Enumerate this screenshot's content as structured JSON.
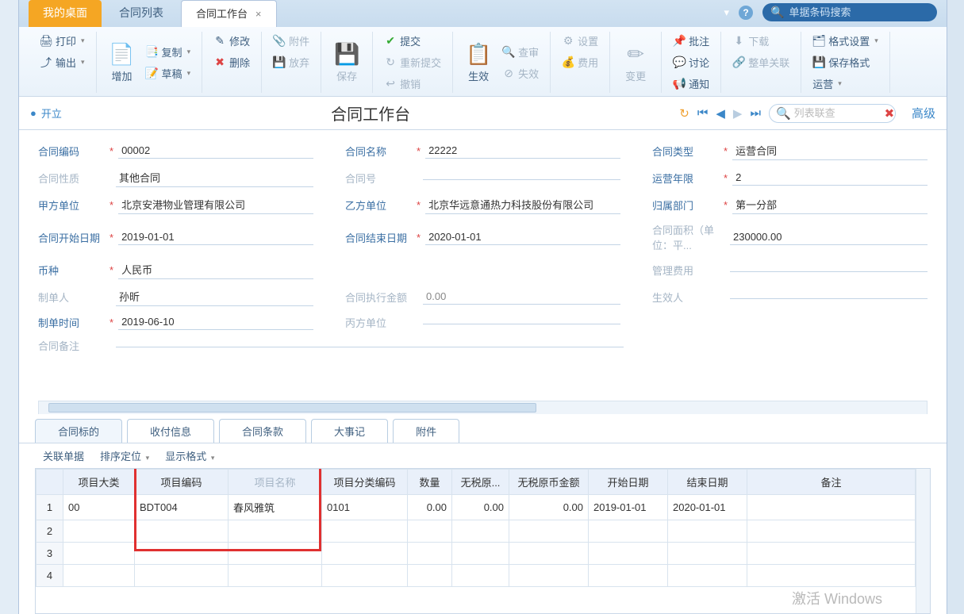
{
  "tabs": {
    "desktop": "我的桌面",
    "list": "合同列表",
    "workbench": "合同工作台",
    "close_x": "×"
  },
  "topsearch": {
    "placeholder": "单据条码搜索"
  },
  "ribbon": {
    "print": "打印",
    "export": "输出",
    "add": "增加",
    "copy": "复制",
    "draft": "草稿",
    "edit": "修改",
    "delete": "删除",
    "attach": "附件",
    "discard": "放弃",
    "save": "保存",
    "submit": "提交",
    "resubmit": "重新提交",
    "revoke": "撤销",
    "effect": "生效",
    "review": "查审",
    "invalid": "失效",
    "settings": "设置",
    "fee": "费用",
    "change": "变更",
    "batch": "批注",
    "discuss": "讨论",
    "notify": "通知",
    "download": "下载",
    "relate": "整单关联",
    "format": "格式设置",
    "savefmt": "保存格式",
    "ops": "运营"
  },
  "status": {
    "label": "开立"
  },
  "page_title": "合同工作台",
  "listsearch": {
    "placeholder": "列表联查"
  },
  "adv": "高级",
  "form": {
    "contract_code_l": "合同编码",
    "contract_code": "00002",
    "contract_name_l": "合同名称",
    "contract_name": "22222",
    "contract_type_l": "合同类型",
    "contract_type": "运营合同",
    "contract_nature_l": "合同性质",
    "contract_nature": "其他合同",
    "contract_no_l": "合同号",
    "contract_no": "",
    "op_years_l": "运营年限",
    "op_years": "2",
    "party_a_l": "甲方单位",
    "party_a": "北京安港物业管理有限公司",
    "party_b_l": "乙方单位",
    "party_b": "北京华远意通热力科技股份有限公司",
    "dept_l": "归属部门",
    "dept": "第一分部",
    "start_l": "合同开始日期",
    "start": "2019-01-01",
    "end_l": "合同结束日期",
    "end": "2020-01-01",
    "area_l": "合同面积（单位：平...",
    "area": "230000.00",
    "currency_l": "币种",
    "currency": "人民币",
    "mgmt_fee_l": "管理费用",
    "mgmt_fee": "",
    "creator_l": "制单人",
    "creator": "孙昕",
    "exec_amt_l": "合同执行金额",
    "exec_amt": "0.00",
    "effector_l": "生效人",
    "effector": "",
    "create_time_l": "制单时间",
    "create_time": "2019-06-10",
    "party_c_l": "丙方单位",
    "party_c": "",
    "remark_l": "合同备注",
    "remark": ""
  },
  "btabs": {
    "t1": "合同标的",
    "t2": "收付信息",
    "t3": "合同条款",
    "t4": "大事记",
    "t5": "附件"
  },
  "tools": {
    "rel": "关联单据",
    "sort": "排序定位",
    "fmt": "显示格式"
  },
  "grid": {
    "headers": {
      "cat": "项目大类",
      "code": "项目编码",
      "name": "项目名称",
      "clscode": "项目分类编码",
      "qty": "数量",
      "notax": "无税原...",
      "notaxamt": "无税原币金额",
      "sdate": "开始日期",
      "edate": "结束日期",
      "remark": "备注"
    },
    "row1": {
      "cat": "00",
      "code": "BDT004",
      "name": "春风雅筑",
      "clscode": "0101",
      "qty": "0.00",
      "notax": "0.00",
      "notaxamt": "0.00",
      "sdate": "2019-01-01",
      "edate": "2020-01-01",
      "remark": ""
    }
  },
  "watermark": "激活 Windows"
}
